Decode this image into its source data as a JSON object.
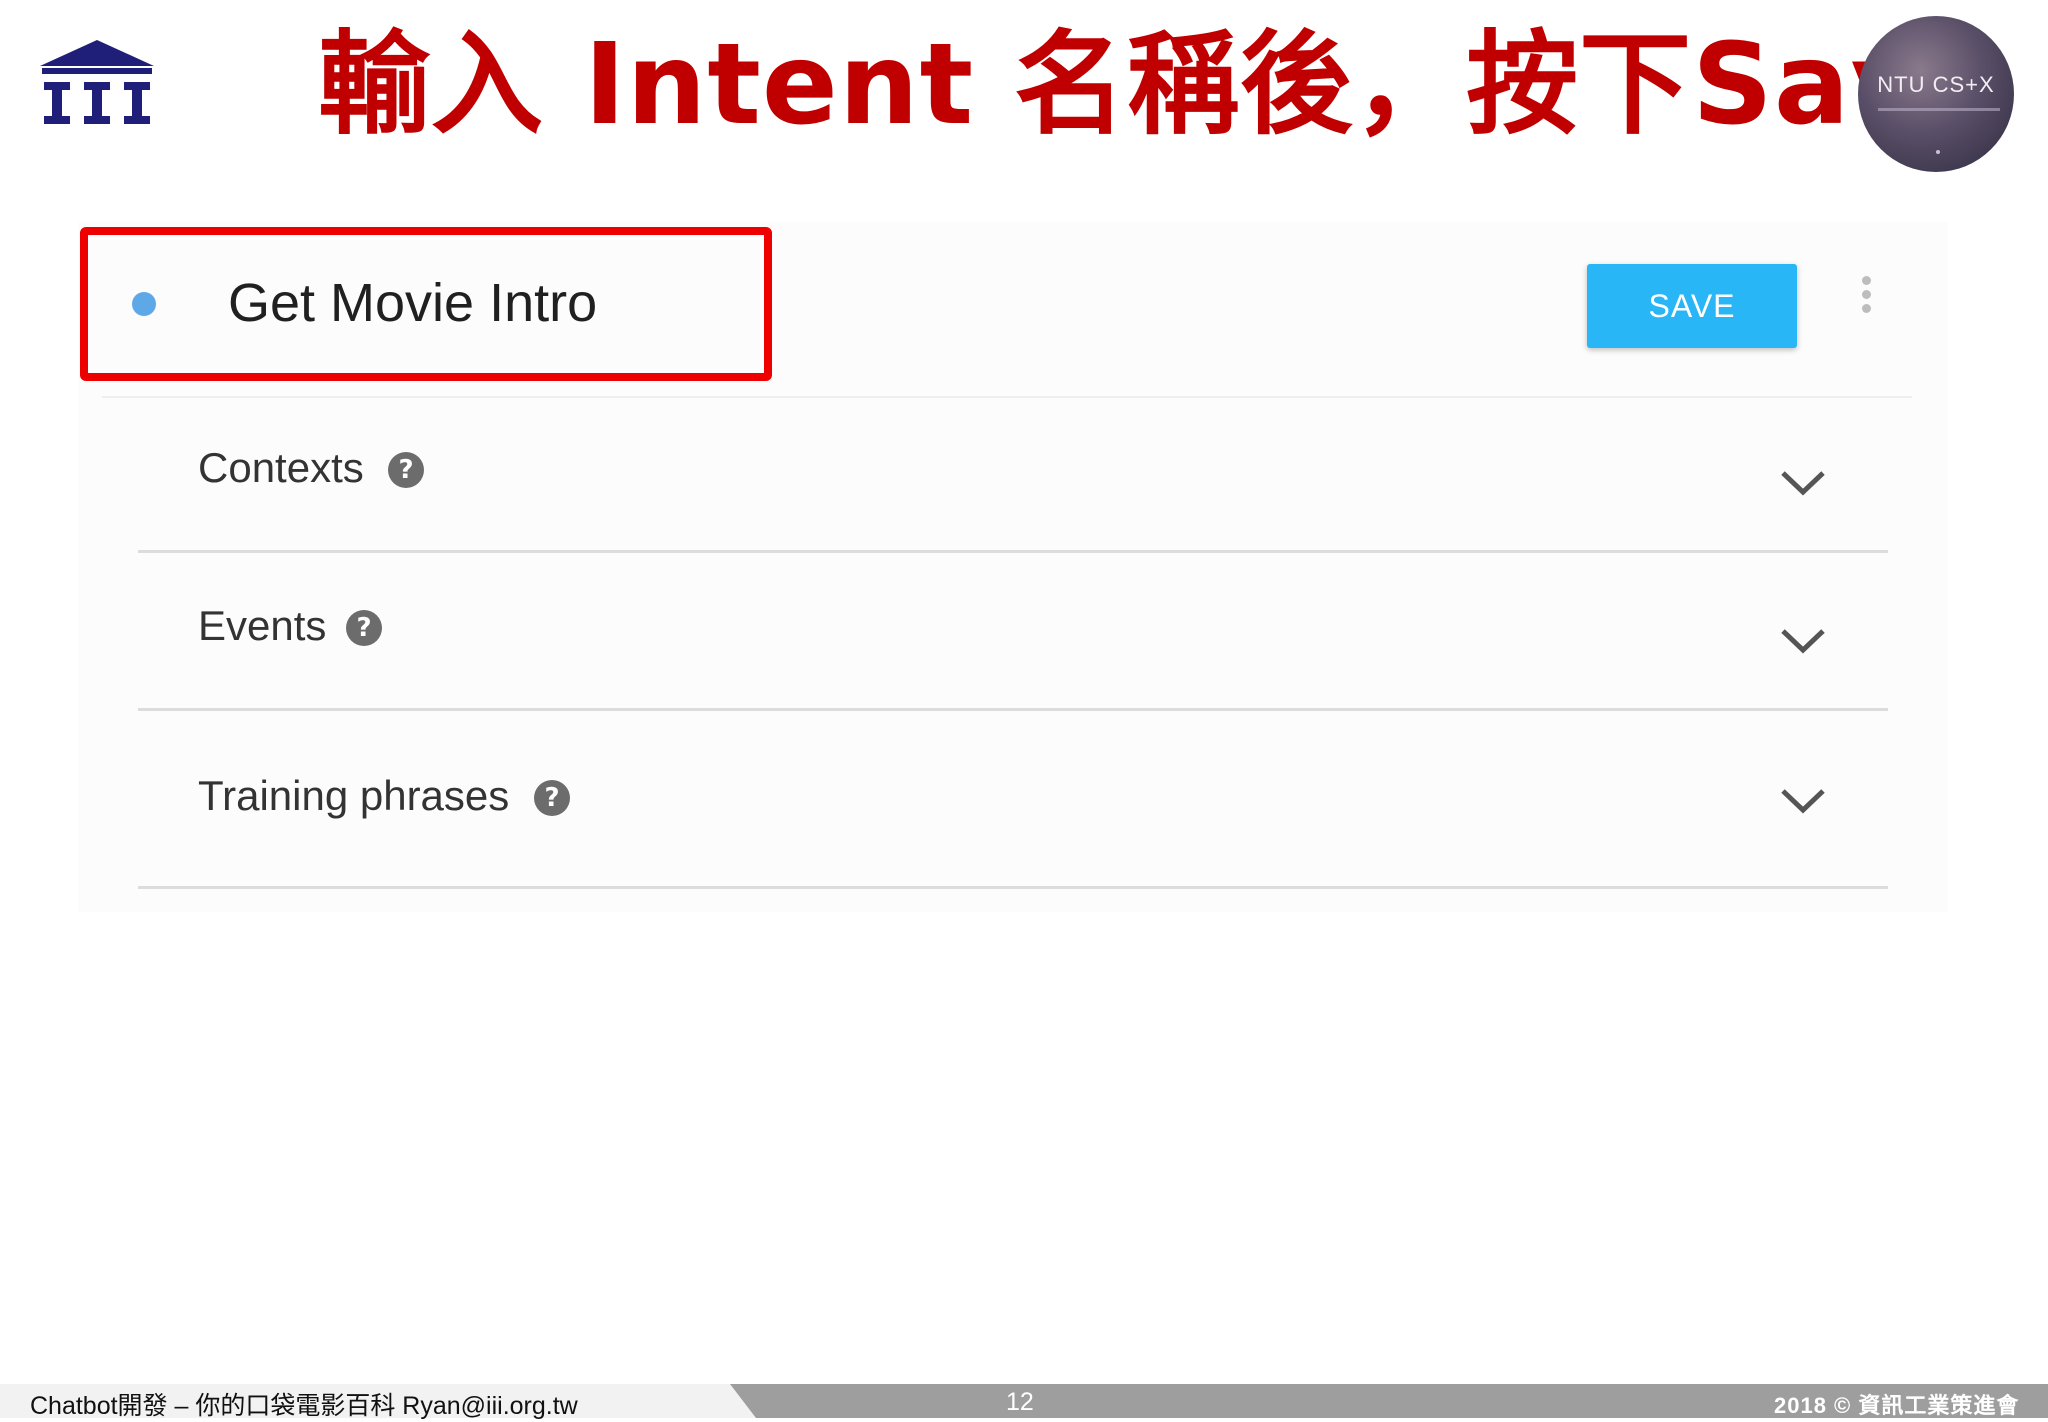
{
  "slide": {
    "title": "輸入 Intent 名稱後，按下Save",
    "badge_text": "NTU CS+X"
  },
  "intent_editor": {
    "intent_name": "Get Movie Intro",
    "save_label": "SAVE",
    "sections": [
      {
        "label": "Contexts",
        "help": "?"
      },
      {
        "label": "Events",
        "help": "?"
      },
      {
        "label": "Training phrases",
        "help": "?"
      }
    ]
  },
  "footer": {
    "left_text": "Chatbot開發 – 你的口袋電影百科 Ryan@iii.org.tw",
    "page_number": "12",
    "right_text": "2018 © 資訊工業策進會"
  },
  "colors": {
    "title": "#c00000",
    "highlight_box": "#ee0000",
    "save_button": "#29b6f6",
    "status_dot": "#5fa8e8",
    "logo": "#1f1f7a"
  },
  "icons": [
    "institute-logo",
    "more-vert-icon",
    "help-icon",
    "chevron-down-icon"
  ]
}
